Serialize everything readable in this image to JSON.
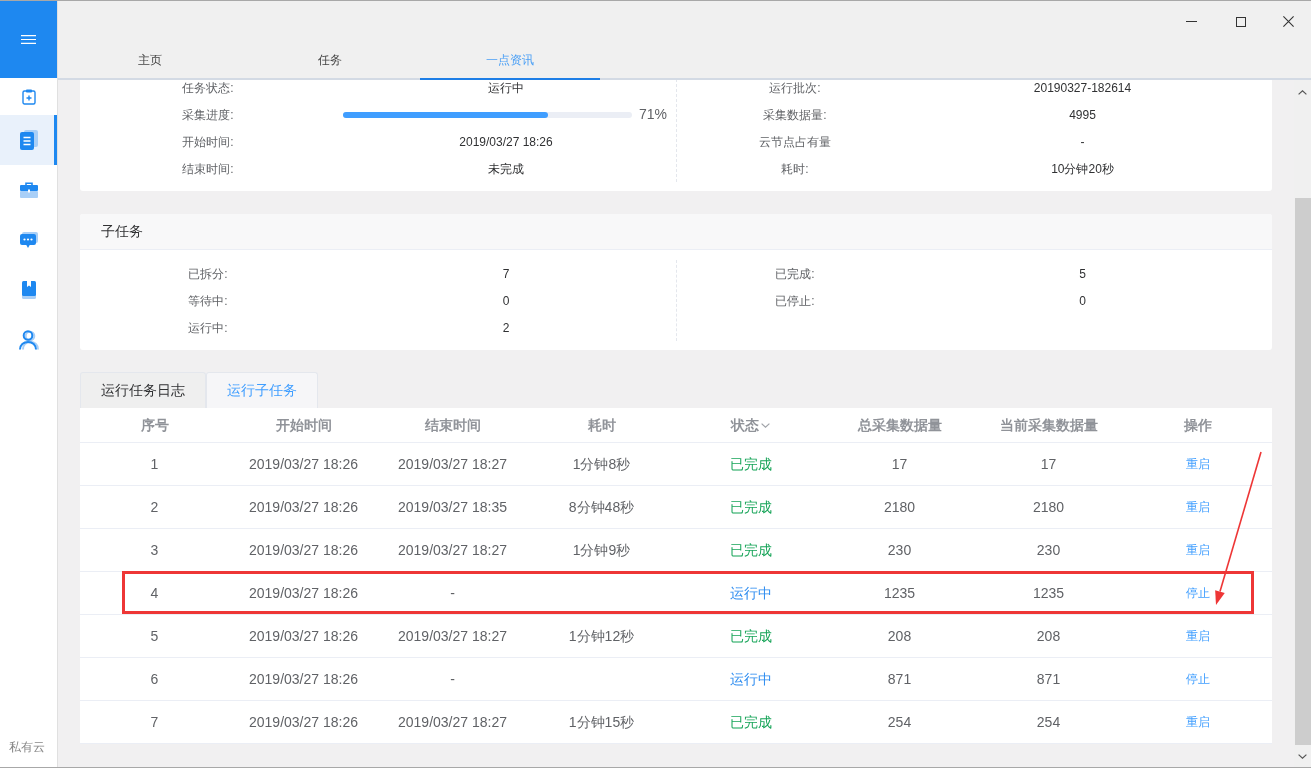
{
  "sidebar": {
    "items": [
      {
        "selected": false
      },
      {
        "selected": true
      },
      {
        "selected": false
      },
      {
        "selected": false
      },
      {
        "selected": false
      },
      {
        "selected": false
      }
    ],
    "footer": "私有云"
  },
  "nav_tabs": [
    {
      "label": "主页",
      "selected": false
    },
    {
      "label": "任务",
      "selected": false
    },
    {
      "label": "一点资讯",
      "selected": true
    }
  ],
  "task_info": {
    "left": [
      {
        "kind": "text",
        "label": "任务状态:",
        "value": "运行中"
      },
      {
        "kind": "progress",
        "label": "采集进度:",
        "level": 0.71,
        "reading": "71%"
      },
      {
        "kind": "text",
        "label": "开始时间:",
        "value": "2019/03/27 18:26"
      },
      {
        "kind": "text",
        "label": "结束时间:",
        "value": "未完成"
      }
    ],
    "right": [
      {
        "kind": "text",
        "label": "运行批次:",
        "value": "20190327-182614"
      },
      {
        "kind": "text",
        "label": "采集数据量:",
        "value": "4995"
      },
      {
        "kind": "text",
        "label": "云节点占有量",
        "value": "-"
      },
      {
        "kind": "text",
        "label": "耗时:",
        "value": "10分钟20秒"
      }
    ]
  },
  "subtasks": {
    "title": "子任务",
    "left": [
      {
        "kind": "text",
        "label": "已拆分:",
        "value": "7"
      },
      {
        "kind": "text",
        "label": "等待中:",
        "value": "0"
      },
      {
        "kind": "text",
        "label": "运行中:",
        "value": "2"
      }
    ],
    "right": [
      {
        "kind": "text",
        "label": "已完成:",
        "value": "5"
      },
      {
        "kind": "text",
        "label": "已停止:",
        "value": "0"
      }
    ]
  },
  "log_tabs": [
    {
      "label": "运行任务日志",
      "selected": false
    },
    {
      "label": "运行子任务",
      "selected": true
    }
  ],
  "table": {
    "columns": [
      {
        "label": "序号",
        "sortable": false
      },
      {
        "label": "开始时间",
        "sortable": false
      },
      {
        "label": "结束时间",
        "sortable": false
      },
      {
        "label": "耗时",
        "sortable": false
      },
      {
        "label": "状态",
        "sortable": true
      },
      {
        "label": "总采集数据量",
        "sortable": false
      },
      {
        "label": "当前采集数据量",
        "sortable": false
      },
      {
        "label": "操作",
        "sortable": false
      }
    ],
    "rows": [
      {
        "index": "1",
        "start": "2019/03/27 18:26",
        "end": "2019/03/27 18:27",
        "duration": "1分钟8秒",
        "status": {
          "text": "已完成",
          "color": "#19a55a"
        },
        "total": "17",
        "current": "17",
        "action": "重启",
        "highlighted": false
      },
      {
        "index": "2",
        "start": "2019/03/27 18:26",
        "end": "2019/03/27 18:35",
        "duration": "8分钟48秒",
        "status": {
          "text": "已完成",
          "color": "#19a55a"
        },
        "total": "2180",
        "current": "2180",
        "action": "重启",
        "highlighted": false
      },
      {
        "index": "3",
        "start": "2019/03/27 18:26",
        "end": "2019/03/27 18:27",
        "duration": "1分钟9秒",
        "status": {
          "text": "已完成",
          "color": "#19a55a"
        },
        "total": "230",
        "current": "230",
        "action": "重启",
        "highlighted": false
      },
      {
        "index": "4",
        "start": "2019/03/27 18:26",
        "end": "-",
        "status": {
          "text": "运行中",
          "color": "#2d8cf0"
        },
        "total": "1235",
        "current": "1235",
        "action": "停止",
        "highlighted": true
      },
      {
        "index": "5",
        "start": "2019/03/27 18:26",
        "end": "2019/03/27 18:27",
        "duration": "1分钟12秒",
        "status": {
          "text": "已完成",
          "color": "#19a55a"
        },
        "total": "208",
        "current": "208",
        "action": "重启",
        "highlighted": false
      },
      {
        "index": "6",
        "start": "2019/03/27 18:26",
        "end": "-",
        "status": {
          "text": "运行中",
          "color": "#2d8cf0"
        },
        "total": "871",
        "current": "871",
        "action": "停止",
        "highlighted": false
      },
      {
        "index": "7",
        "start": "2019/03/27 18:26",
        "end": "2019/03/27 18:27",
        "duration": "1分钟15秒",
        "status": {
          "text": "已完成",
          "color": "#19a55a"
        },
        "total": "254",
        "current": "254",
        "action": "重启",
        "highlighted": false
      }
    ]
  }
}
